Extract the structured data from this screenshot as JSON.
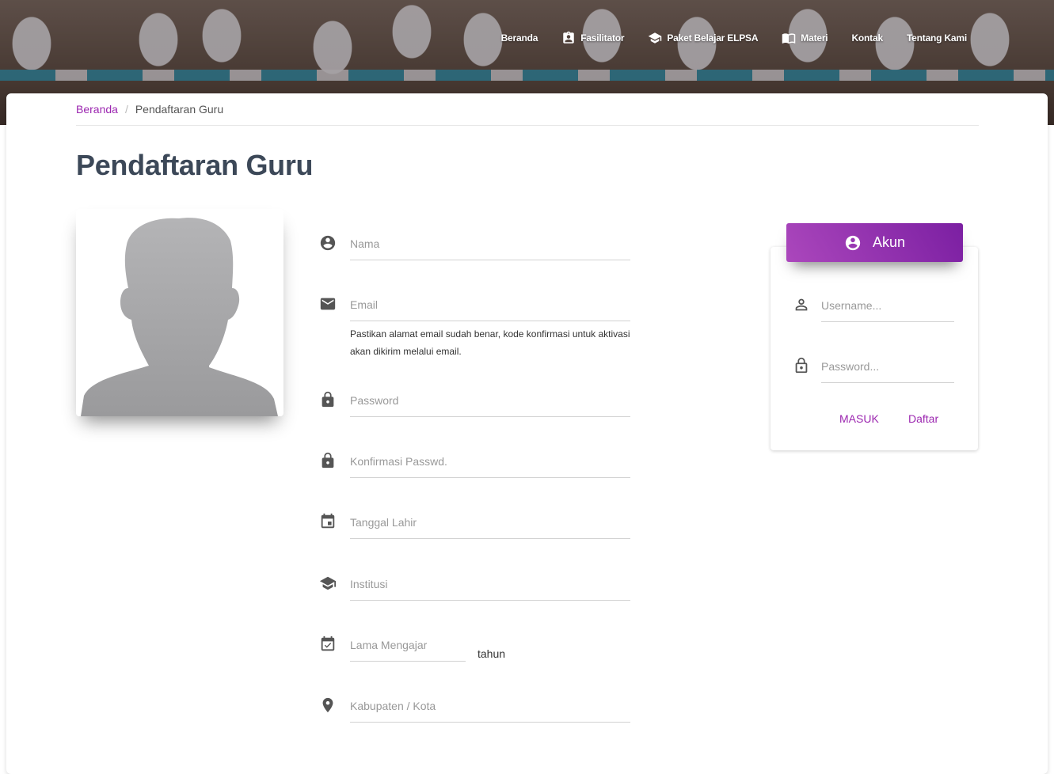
{
  "nav": {
    "items": [
      {
        "label": "Beranda",
        "icon": ""
      },
      {
        "label": "Fasilitator",
        "icon": "badge-icon"
      },
      {
        "label": "Paket Belajar ELPSA",
        "icon": "school-icon"
      },
      {
        "label": "Materi",
        "icon": "book-icon"
      },
      {
        "label": "Kontak",
        "icon": ""
      },
      {
        "label": "Tentang Kami",
        "icon": ""
      }
    ]
  },
  "breadcrumb": {
    "home": "Beranda",
    "separator": "/",
    "current": "Pendaftaran Guru"
  },
  "page": {
    "title": "Pendaftaran Guru"
  },
  "form": {
    "nama": {
      "placeholder": "Nama",
      "value": ""
    },
    "email": {
      "placeholder": "Email",
      "value": "",
      "helper": "Pastikan alamat email sudah benar, kode konfirmasi untuk aktivasi akan dikirim melalui email."
    },
    "password": {
      "placeholder": "Password",
      "value": ""
    },
    "konfirmasi": {
      "placeholder": "Konfirmasi Passwd.",
      "value": ""
    },
    "tanggal_lahir": {
      "placeholder": "Tanggal Lahir",
      "value": ""
    },
    "institusi": {
      "placeholder": "Institusi",
      "value": ""
    },
    "lama_mengajar": {
      "placeholder": "Lama Mengajar",
      "value": "",
      "unit": "tahun"
    },
    "kabupaten": {
      "placeholder": "Kabupaten / Kota",
      "value": ""
    }
  },
  "login": {
    "header": "Akun",
    "username_placeholder": "Username...",
    "password_placeholder": "Password...",
    "masuk_label": "MASUK",
    "daftar_label": "Daftar"
  },
  "colors": {
    "accent": "#9c27b0",
    "title": "#3c4858"
  }
}
